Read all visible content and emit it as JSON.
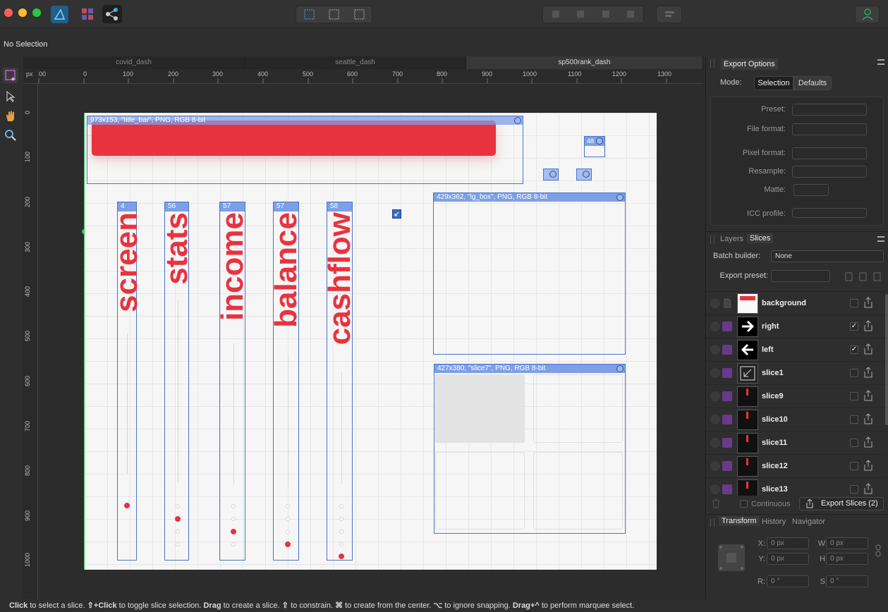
{
  "context": {
    "selection": "No Selection"
  },
  "tabs": [
    {
      "label": "covid_dash",
      "active": false
    },
    {
      "label": "seattle_dash",
      "active": false
    },
    {
      "label": "sp500rank_dash",
      "active": true
    }
  ],
  "ruler": {
    "h_labels": [
      "00",
      "0",
      "100",
      "200",
      "300",
      "400",
      "500",
      "600",
      "700",
      "800",
      "900",
      "1000",
      "1100",
      "1200",
      "1300"
    ],
    "v_labels": [
      "0",
      "100",
      "200",
      "300",
      "400",
      "500",
      "600",
      "700",
      "800",
      "900",
      "1000"
    ],
    "unit": "px"
  },
  "slices": {
    "title_bar": "973x153, \"title_bar\", PNG, RGB 8-bit",
    "lg_box": "429x362, \"lg_box\", PNG, RGB 8-bit",
    "slice7": "427x380, \"slice7\", PNG, RGB 8-bit",
    "small_48": "48",
    "col_labels": [
      "4",
      "56",
      "57",
      "57",
      "58"
    ]
  },
  "canvas_words": [
    "screen",
    "stats",
    "income",
    "balance",
    "cashflow"
  ],
  "status": {
    "b1": "Click",
    "t1": " to select a slice. ",
    "b2": "⇧+Click",
    "t2": " to toggle slice selection. ",
    "b3": "Drag",
    "t3": " to create a slice. ",
    "b4": "⇧",
    "t4": " to constrain. ",
    "b5": "⌘",
    "t5": " to create from the center. ",
    "b6": "⌥",
    "t6": " to ignore snapping. ",
    "b7": "Drag+^",
    "t7": " to perform marquee select."
  },
  "export_options": {
    "title": "Export Options",
    "mode_label": "Mode:",
    "mode_selection": "Selection",
    "mode_defaults": "Defaults",
    "preset_label": "Preset:",
    "file_format_label": "File format:",
    "pixel_format_label": "Pixel format:",
    "resample_label": "Resample:",
    "matte_label": "Matte:",
    "icc_label": "ICC profile:"
  },
  "slices_panel": {
    "tab_layers": "Layers",
    "tab_slices": "Slices",
    "batch_label": "Batch builder:",
    "batch_value": "None",
    "export_preset_label": "Export preset:",
    "continuous_label": "Continuous",
    "export_button": "Export Slices (2)",
    "rows": [
      {
        "name": "background",
        "checked": false
      },
      {
        "name": "right",
        "checked": true
      },
      {
        "name": "left",
        "checked": true
      },
      {
        "name": "slice1",
        "checked": false
      },
      {
        "name": "slice9",
        "checked": false
      },
      {
        "name": "slice10",
        "checked": false
      },
      {
        "name": "slice11",
        "checked": false
      },
      {
        "name": "slice12",
        "checked": false
      },
      {
        "name": "slice13",
        "checked": false
      }
    ]
  },
  "transform": {
    "tab_transform": "Transform",
    "tab_history": "History",
    "tab_navigator": "Navigator",
    "x_label": "X:",
    "x_value": "0 px",
    "w_label": "W:",
    "w_value": "0 px",
    "y_label": "Y:",
    "y_value": "0 px",
    "h_label": "H:",
    "h_value": "0 px",
    "r_label": "R:",
    "r_value": "0 °",
    "s_label": "S:",
    "s_value": "0 °"
  },
  "colors": {
    "accent_blue": "#4a74c9",
    "slice_header": "#7e9fe6",
    "red": "#e8333f",
    "green_user": "#2ea86a"
  }
}
